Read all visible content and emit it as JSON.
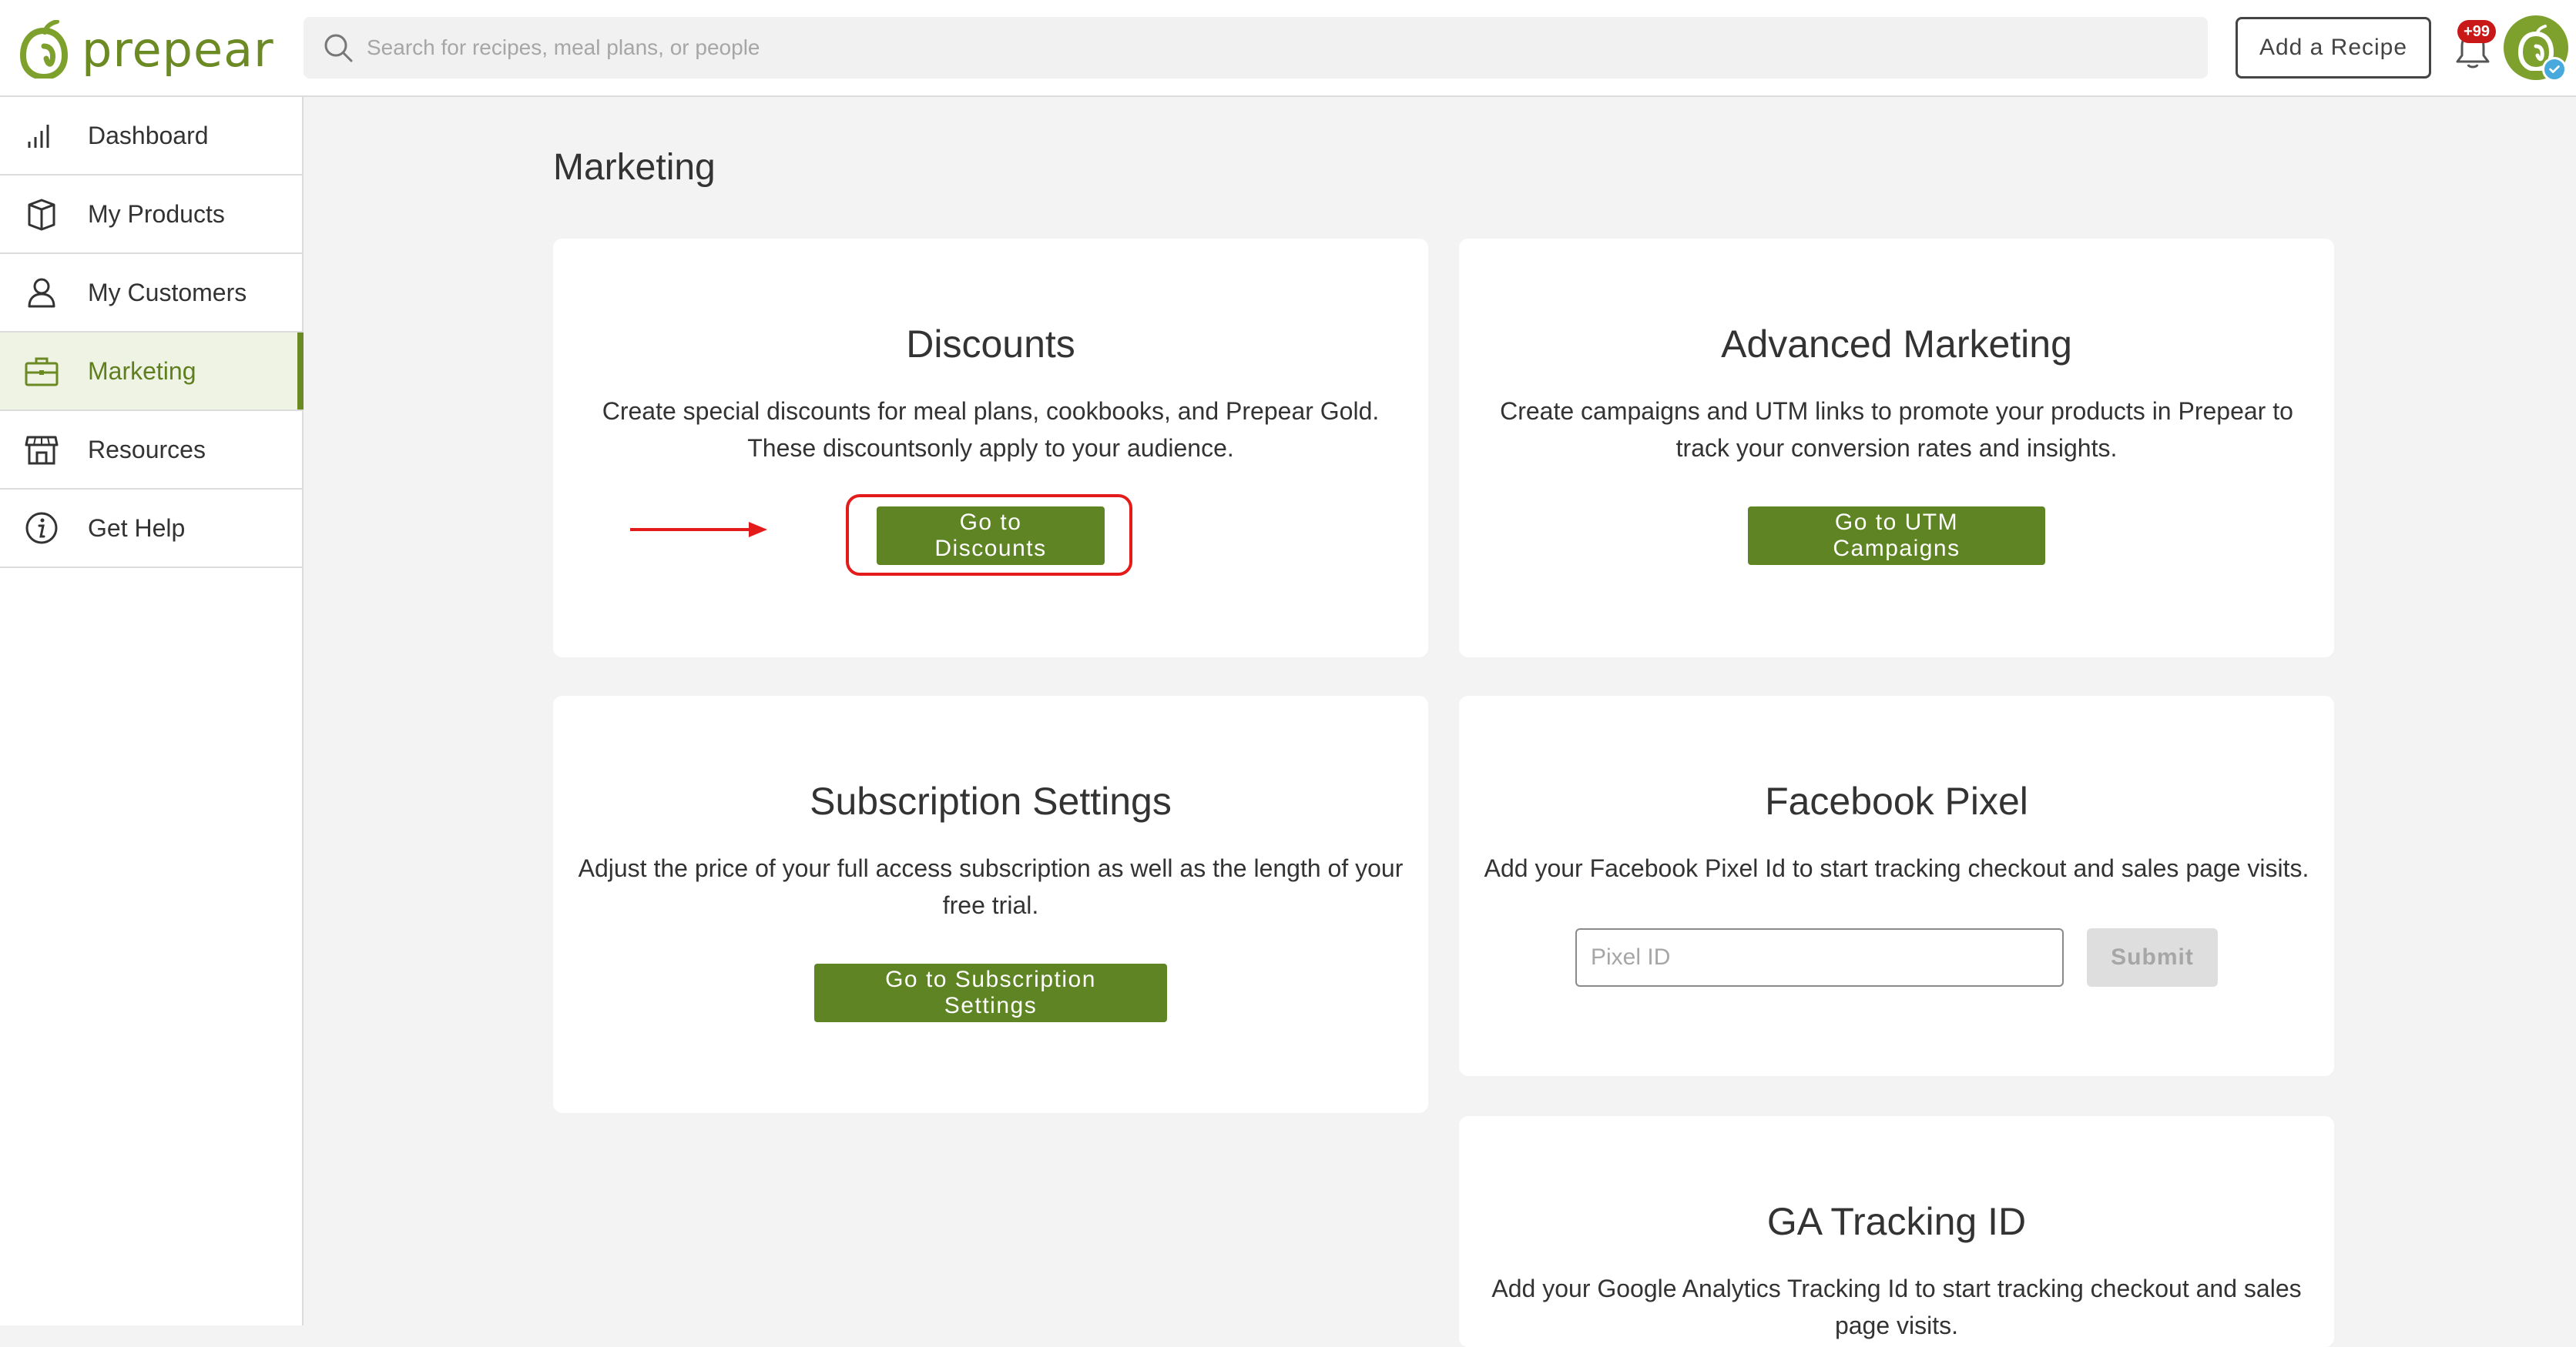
{
  "brand": {
    "name": "prepear",
    "color": "#6b8a24"
  },
  "header": {
    "search_placeholder": "Search for recipes, meal plans, or people",
    "add_recipe_label": "Add a Recipe",
    "notification_badge": "+99"
  },
  "sidebar": {
    "items": [
      {
        "label": "Dashboard",
        "icon": "bar-chart-icon"
      },
      {
        "label": "My Products",
        "icon": "box-icon"
      },
      {
        "label": "My Customers",
        "icon": "person-icon"
      },
      {
        "label": "Marketing",
        "icon": "briefcase-icon",
        "active": true
      },
      {
        "label": "Resources",
        "icon": "storefront-icon"
      },
      {
        "label": "Get Help",
        "icon": "info-icon"
      }
    ]
  },
  "main": {
    "title": "Marketing",
    "cards": {
      "discounts": {
        "title": "Discounts",
        "desc_line1": "Create special discounts for meal plans, cookbooks, and Prepear Gold.",
        "desc_line2": "These discountsonly apply to your audience.",
        "button": "Go to Discounts"
      },
      "advanced": {
        "title": "Advanced Marketing",
        "desc_line1": "Create campaigns and UTM links to promote your products in Prepear to",
        "desc_line2": "track your conversion rates and insights.",
        "button": "Go to UTM Campaigns"
      },
      "subscription": {
        "title": "Subscription Settings",
        "desc_line1": "Adjust the price of your full access subscription as well as the length of your",
        "desc_line2": "free trial.",
        "button": "Go to Subscription Settings"
      },
      "facebook_pixel": {
        "title": "Facebook Pixel",
        "desc": "Add your Facebook Pixel Id to start tracking checkout and sales page visits.",
        "input_placeholder": "Pixel ID",
        "submit": "Submit"
      },
      "ga_tracking": {
        "title": "GA Tracking ID",
        "desc_line1": "Add your Google Analytics Tracking Id to start tracking checkout and sales",
        "desc_line2": "page visits."
      }
    }
  },
  "colors": {
    "button_green": "#5e8424",
    "annotation_red": "#e31b1b"
  }
}
